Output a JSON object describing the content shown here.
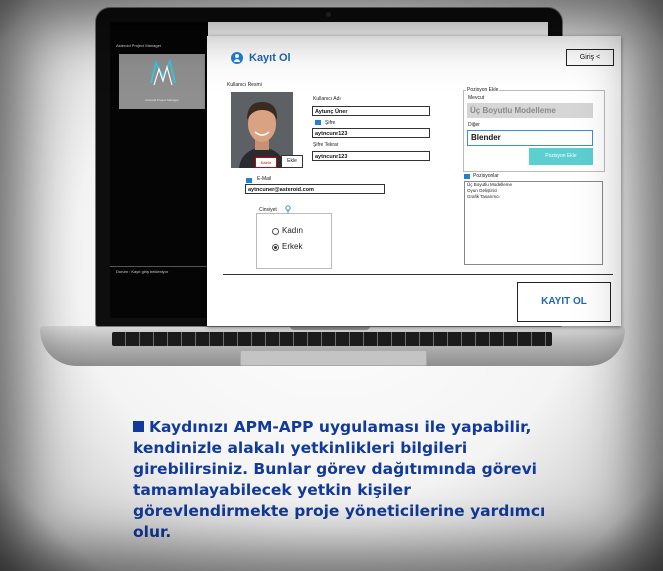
{
  "background_app": {
    "window_title": "Asteroid Project Manager",
    "banner_text": "Asteroid Project Manager",
    "status_text": "Durum : Kayıt giriş bekleniyor"
  },
  "dialog": {
    "title": "Kayıt Ol",
    "login_button": "Giriş <",
    "photo_label": "Kullanıcı Resmi",
    "remove_button": "Kaldır",
    "add_button": "Ekle",
    "username_label": "Kullanıcı Adı",
    "username_value": "Aytunç Üner",
    "password_label": "Şifre",
    "password_value": "aytncunr123",
    "password_repeat_label": "Şifre Tekrar",
    "password_repeat_value": "aytncunr123",
    "email_label": "E-Mail",
    "email_value": "aytncuner@asteroid.com",
    "gender_label": "Cinsiyet",
    "gender_options": [
      "Kadın",
      "Erkek"
    ],
    "gender_selected": "Erkek",
    "position_add_group": "Pozisyon Ekle",
    "existing_label": "Mevcut",
    "existing_value": "Üç Boyutlu Modelleme",
    "other_label": "Diğer",
    "other_value": "Blender",
    "position_add_button": "Pozisyon Ekle",
    "positions_label": "Pozisyonlar",
    "positions": [
      "Üç Boyutlu Modelleme",
      "Oyun Geliştirici",
      "Grafik Tasarımcı"
    ],
    "register_button": "KAYIT OL"
  },
  "caption": "Kaydınızı APM-APP uygulaması ile yapabilir, kendinizle alakalı yetkinlikleri bilgileri girebilirsiniz. Bunlar görev dağıtımında görevi tamamlayabilecek yetkin kişiler görevlendirmekte proje yöneticilerine yardımcı olur.",
  "colors": {
    "accent": "#1f66b8",
    "caption": "#123a9a",
    "position_button": "#5ccfd1",
    "remove_red": "#d00000"
  }
}
